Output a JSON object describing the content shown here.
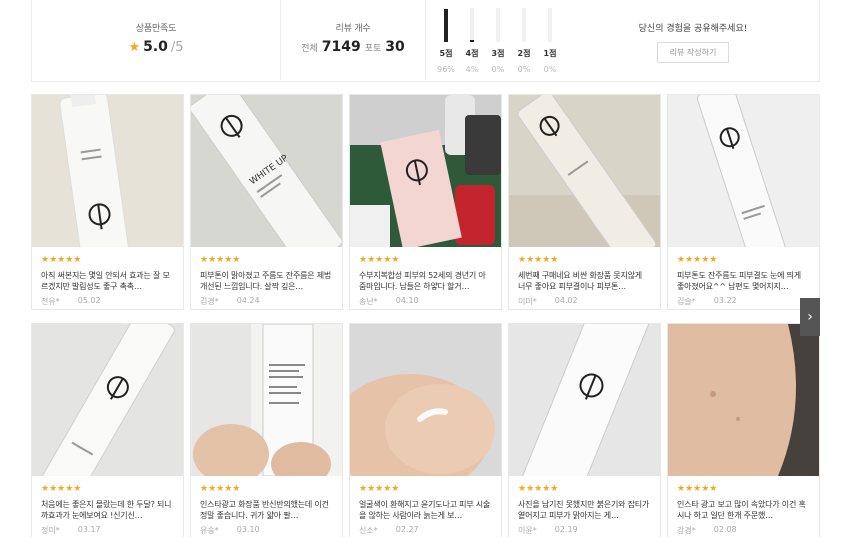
{
  "summary": {
    "rating_label": "상품만족도",
    "rating_value": "5.0",
    "rating_max": "/5",
    "review_label": "리뷰 개수",
    "review_total_label": "전체",
    "review_total": "7149",
    "review_photo_label": "포토",
    "review_photo": "30",
    "bars": [
      {
        "label": "5점",
        "pct": "96%",
        "value": 0.96
      },
      {
        "label": "4점",
        "pct": "4%",
        "value": 0.04
      },
      {
        "label": "3점",
        "pct": "0%",
        "value": 0
      },
      {
        "label": "2점",
        "pct": "0%",
        "value": 0
      },
      {
        "label": "1점",
        "pct": "0%",
        "value": 0
      }
    ],
    "share_text": "당신의 경험을 공유해주세요!",
    "write_button": "리뷰 작성하기"
  },
  "reviews": [
    {
      "stars": "★★★★★",
      "text": "아직 써본지는 몇일 안되서 효과는 잘 모르겠지만 발림성도 좋구 촉촉…",
      "user": "전유*",
      "date": "05.02"
    },
    {
      "stars": "★★★★★",
      "text": "피부톤이 맑아졌고 주름도 잔주름은 제법 개선된 느낌입니다. 살짝 깊은…",
      "user": "김경*",
      "date": "04.24"
    },
    {
      "stars": "★★★★★",
      "text": "수부지복합성 피부의 52세의 경년기 아줌마입니다. 남들은 하얗다 할거…",
      "user": "송난*",
      "date": "04.10"
    },
    {
      "stars": "★★★★★",
      "text": "세번째 구매네요 비싼 화장품 못지않게 너무 좋아요 피부결이나 피부톤…",
      "user": "이미*",
      "date": "04.02"
    },
    {
      "stars": "★★★★★",
      "text": "피부톤도 잔주름도 피부결도 눈에 띄게 좋아졌어요^^ 남편도 몇어지지…",
      "user": "김슬*",
      "date": "03.22"
    },
    {
      "stars": "★★★★★",
      "text": "처음에는 좋은지 몰랐는데 한 두달? 되니까효과가 눈에보여요 !신기신…",
      "user": "정미*",
      "date": "03.17"
    },
    {
      "stars": "★★★★★",
      "text": "인스타광고 화장품 반신반의했는데 이건 정말 좋습니다. 귀가 얇아 팔…",
      "user": "유송*",
      "date": "03.10"
    },
    {
      "stars": "★★★★★",
      "text": "얼굴색이 환해지고 윤기도나고 피부 시술을 않하는 사람이라 늙는게 보…",
      "user": "신소*",
      "date": "02.27"
    },
    {
      "stars": "★★★★★",
      "text": "사진을 남기진 못했지만 붉은기와 잡티가 옅어지고 피부가 맑아지는 게…",
      "user": "이윤*",
      "date": "02.19"
    },
    {
      "stars": "★★★★★",
      "text": "인스타 광고 보고 많이 속았다가 이건 혹시나 하고 일단 한개 주문했…",
      "user": "강경*",
      "date": "02.08"
    }
  ],
  "photo_texts": {
    "p1": "WHITE UP",
    "p2": "WHITE UP"
  },
  "icons": {
    "next": "chevron-right-icon",
    "star": "star-icon"
  },
  "colors": {
    "star": "#f5a623",
    "bar": "#222222",
    "arrow_bg": "#555555"
  }
}
